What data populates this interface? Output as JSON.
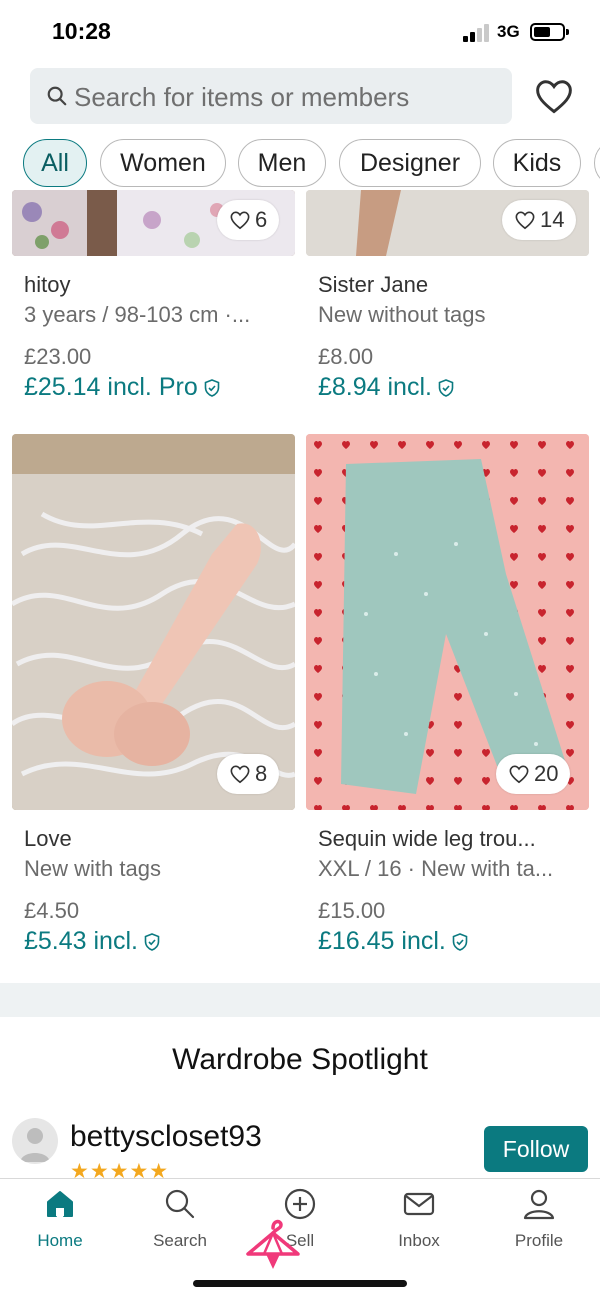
{
  "status": {
    "time": "10:28",
    "network": "3G"
  },
  "search": {
    "placeholder": "Search for items or members"
  },
  "chips": [
    "All",
    "Women",
    "Men",
    "Designer",
    "Kids"
  ],
  "products": [
    {
      "title": "hitoy",
      "subtitle": "3 years / 98-103 cm ·...",
      "price": "£23.00",
      "price_incl": "£25.14 incl. Pro",
      "likes": "6"
    },
    {
      "title": "Sister Jane",
      "subtitle": "New without tags",
      "price": "£8.00",
      "price_incl": "£8.94 incl.",
      "likes": "14"
    },
    {
      "title": "Love",
      "subtitle": "New with tags",
      "price": "£4.50",
      "price_incl": "£5.43 incl.",
      "likes": "8"
    },
    {
      "title": "Sequin wide leg trou...",
      "subtitle": "XXL / 16 · New with ta...",
      "price": "£15.00",
      "price_incl": "£16.45 incl.",
      "likes": "20"
    }
  ],
  "spotlight": {
    "title": "Wardrobe Spotlight",
    "username": "bettyscloset93",
    "stars": "★★★★★",
    "follow_label": "Follow"
  },
  "tabs": [
    {
      "label": "Home",
      "icon": "home-icon",
      "active": true
    },
    {
      "label": "Search",
      "icon": "search-icon"
    },
    {
      "label": "Sell",
      "icon": "plus-circle-icon"
    },
    {
      "label": "Inbox",
      "icon": "envelope-icon"
    },
    {
      "label": "Profile",
      "icon": "person-icon"
    }
  ],
  "colors": {
    "accent": "#0b7a80",
    "chip_active_bg": "#e3f1f2",
    "star": "#f3a81f",
    "hanger_overlay": "#f0397a"
  }
}
